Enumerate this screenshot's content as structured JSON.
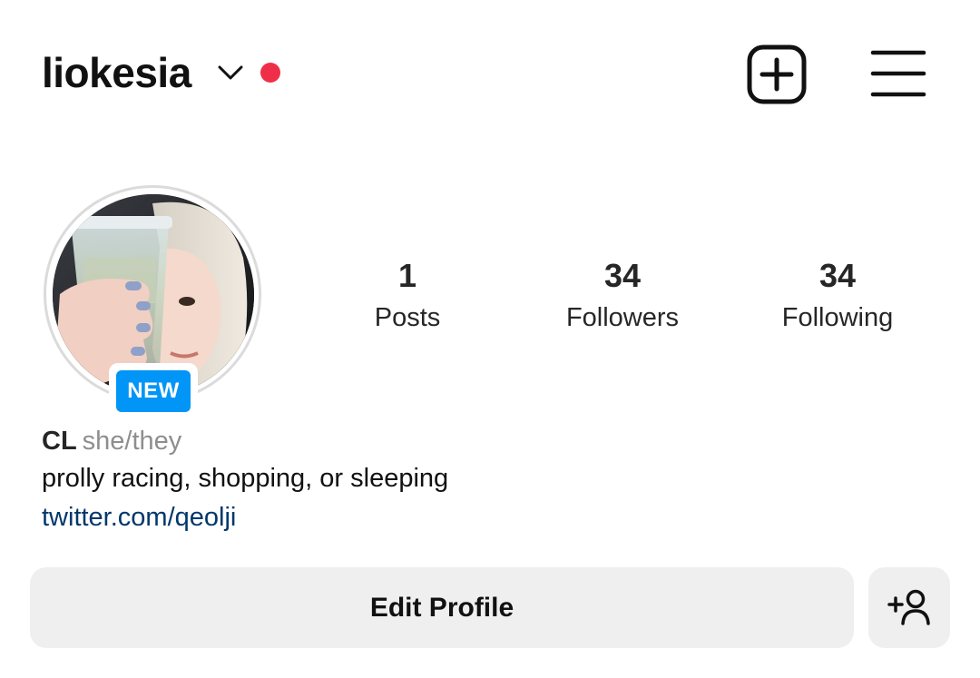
{
  "header": {
    "username": "liokesia",
    "notification_dot_color": "#ef2f48",
    "icons": [
      "chevron-down-icon",
      "create-post-icon",
      "hamburger-menu-icon"
    ]
  },
  "profile": {
    "avatar_badge": "NEW",
    "badge_color": "#0095f6",
    "stats": [
      {
        "value": "1",
        "label": "Posts"
      },
      {
        "value": "34",
        "label": "Followers"
      },
      {
        "value": "34",
        "label": "Following"
      }
    ]
  },
  "bio": {
    "name": "CL",
    "pronouns": "she/they",
    "text": "prolly racing, shopping, or sleeping",
    "link": "twitter.com/qeolji",
    "link_color": "#00376b"
  },
  "actions": {
    "edit_profile_label": "Edit Profile",
    "add_user_icon": "add-person-icon"
  }
}
